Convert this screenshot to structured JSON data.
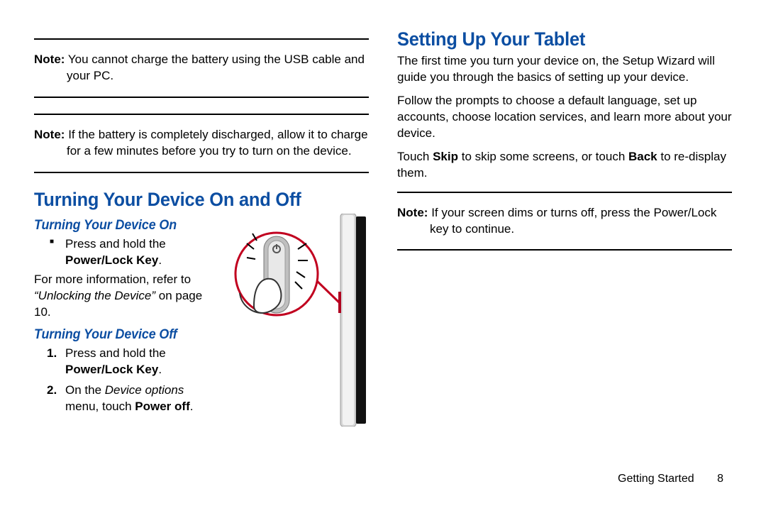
{
  "left": {
    "note1_label": "Note:",
    "note1_text": "You cannot charge the battery using the USB cable and your PC.",
    "note2_label": "Note:",
    "note2_text": "If the battery is completely discharged, allow it to charge for a few minutes before you try to turn on the device.",
    "h2": "Turning Your Device On and Off",
    "h3_on": "Turning Your Device On",
    "on_bullet_pre": "Press and hold the ",
    "on_bullet_bold": "Power/Lock Key",
    "on_bullet_post": ".",
    "on_more_pre": "For more information, refer to ",
    "on_more_ital": "“Unlocking the Device” ",
    "on_more_post": "on page 10.",
    "h3_off": "Turning Your Device Off",
    "off_step1_num": "1.",
    "off_step1_pre": "Press and hold the ",
    "off_step1_bold": "Power/Lock Key",
    "off_step1_post": ".",
    "off_step2_num": "2.",
    "off_step2_pre": "On the ",
    "off_step2_ital": "Device options",
    "off_step2_mid": " menu, touch ",
    "off_step2_bold": "Power off",
    "off_step2_post": "."
  },
  "right": {
    "h2": "Setting Up Your Tablet",
    "p1": "The first time you turn your device on, the Setup Wizard will guide you through the basics of setting up your device.",
    "p2": "Follow the prompts to choose a default language, set up accounts, choose location services, and learn more about your device.",
    "p3_pre": "Touch ",
    "p3_b1": "Skip",
    "p3_mid": " to skip some screens, or touch ",
    "p3_b2": "Back",
    "p3_post": " to re-display them.",
    "note_label": "Note:",
    "note_text": "If your screen dims or turns off, press the Power/Lock key to continue."
  },
  "footer": {
    "section": "Getting Started",
    "page": "8"
  }
}
